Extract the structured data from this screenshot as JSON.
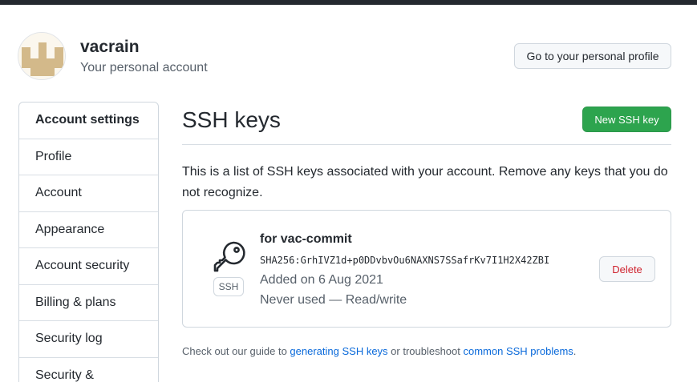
{
  "header": {
    "username": "vacrain",
    "subtitle": "Your personal account",
    "profile_button": "Go to your personal profile"
  },
  "sidebar": {
    "items": [
      {
        "label": "Account settings"
      },
      {
        "label": "Profile"
      },
      {
        "label": "Account"
      },
      {
        "label": "Appearance"
      },
      {
        "label": "Account security"
      },
      {
        "label": "Billing & plans"
      },
      {
        "label": "Security log"
      },
      {
        "label": "Security &"
      }
    ]
  },
  "main": {
    "title": "SSH keys",
    "new_button": "New SSH key",
    "description": "This is a list of SSH keys associated with your account. Remove any keys that you do not recognize.",
    "key": {
      "badge": "SSH",
      "title": "for vac-commit",
      "fingerprint": "SHA256:GrhIVZ1d+p0DDvbvOu6NAXNS7SSafrKv7I1H2X42ZBI",
      "added": "Added on 6 Aug 2021",
      "usage": "Never used — Read/write",
      "delete_button": "Delete",
      "icon": "key-icon"
    },
    "footer": {
      "prefix": "Check out our guide to ",
      "link1": "generating SSH keys",
      "middle": " or troubleshoot ",
      "link2": "common SSH problems",
      "suffix": "."
    }
  },
  "colors": {
    "primary_button": "#2da44e",
    "danger_text": "#cf222e",
    "link": "#0969da",
    "topbar": "#24292f"
  }
}
